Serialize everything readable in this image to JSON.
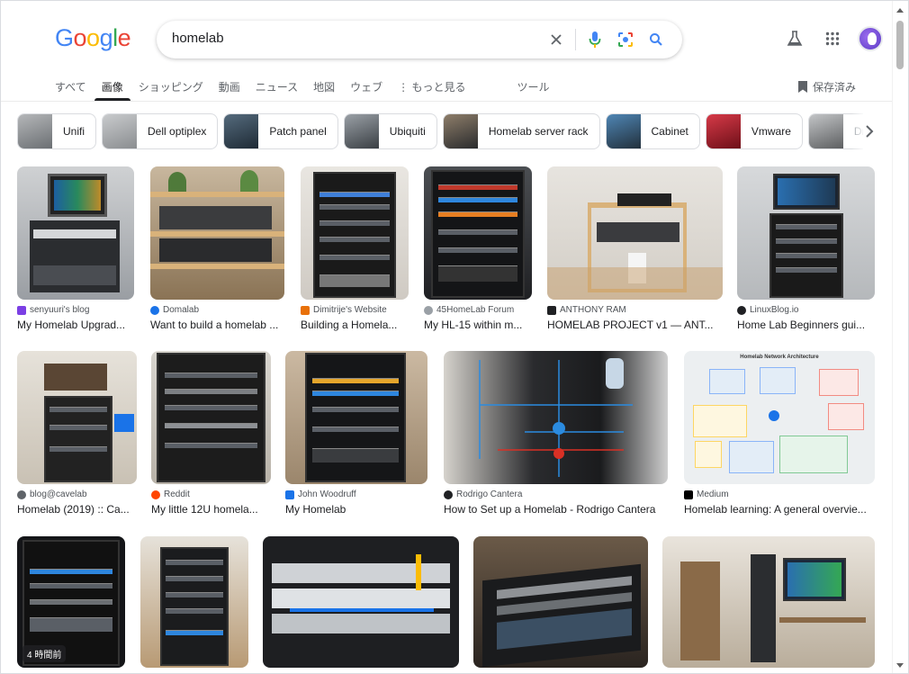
{
  "search": {
    "query": "homelab"
  },
  "logo": {
    "letters": [
      "G",
      "o",
      "o",
      "g",
      "l",
      "e"
    ],
    "colors": [
      "#4285f4",
      "#ea4335",
      "#fbbc05",
      "#4285f4",
      "#34a853",
      "#ea4335"
    ]
  },
  "tabs": [
    {
      "label": "すべて"
    },
    {
      "label": "画像"
    },
    {
      "label": "ショッピング"
    },
    {
      "label": "動画"
    },
    {
      "label": "ニュース"
    },
    {
      "label": "地図"
    },
    {
      "label": "ウェブ"
    },
    {
      "label": "⋮ もっと見る"
    }
  ],
  "tools_label": "ツール",
  "saved_label": "保存済み",
  "chips": [
    {
      "label": "Unifi",
      "thumb": "#6b6f73"
    },
    {
      "label": "Dell optiplex",
      "thumb": "#8a8d90"
    },
    {
      "label": "Patch panel",
      "thumb": "#2d3e4e"
    },
    {
      "label": "Ubiquiti",
      "thumb": "#4a4f55"
    },
    {
      "label": "Homelab server rack",
      "thumb": "#3a3c3f"
    },
    {
      "label": "Cabinet",
      "thumb": "#2f5f8a"
    },
    {
      "label": "Vmware",
      "thumb": "#b21f2d"
    },
    {
      "label": "Drea",
      "thumb": "#77797b"
    }
  ],
  "results_row1": [
    {
      "source": "senyuuri's blog",
      "title": "My Homelab Upgrad...",
      "fav": "#7b3fe4"
    },
    {
      "source": "Domalab",
      "title": "Want to build a homelab ...",
      "fav": "#1a73e8"
    },
    {
      "source": "Dimitrije's Website",
      "title": "Building a Homela...",
      "fav": "#e8710a"
    },
    {
      "source": "45HomeLab Forum",
      "title": "My HL-15 within m...",
      "fav": "#9aa0a6"
    },
    {
      "source": "ANTHONY RAM",
      "title": "HOMELAB PROJECT v1 — ANT...",
      "fav": "#202124"
    },
    {
      "source": "LinuxBlog.io",
      "title": "Home Lab Beginners gui...",
      "fav": "#202124"
    }
  ],
  "results_row2": [
    {
      "source": "blog@cavelab",
      "title": "Homelab (2019) :: Ca...",
      "fav": "#5f6368"
    },
    {
      "source": "Reddit",
      "title": "My little 12U homela...",
      "fav": "#ff4500"
    },
    {
      "source": "John Woodruff",
      "title": "My Homelab",
      "fav": "#1a73e8"
    },
    {
      "source": "Rodrigo Cantera",
      "title": "How to Set up a Homelab - Rodrigo Cantera",
      "fav": "#202124"
    },
    {
      "source": "Medium",
      "title": "Homelab learning: A general overvie...",
      "fav": "#000000"
    }
  ],
  "results_row3": [
    {
      "badge": "4 時間前"
    },
    {},
    {},
    {},
    {}
  ],
  "diagram_title": "Homelab Network Architecture"
}
